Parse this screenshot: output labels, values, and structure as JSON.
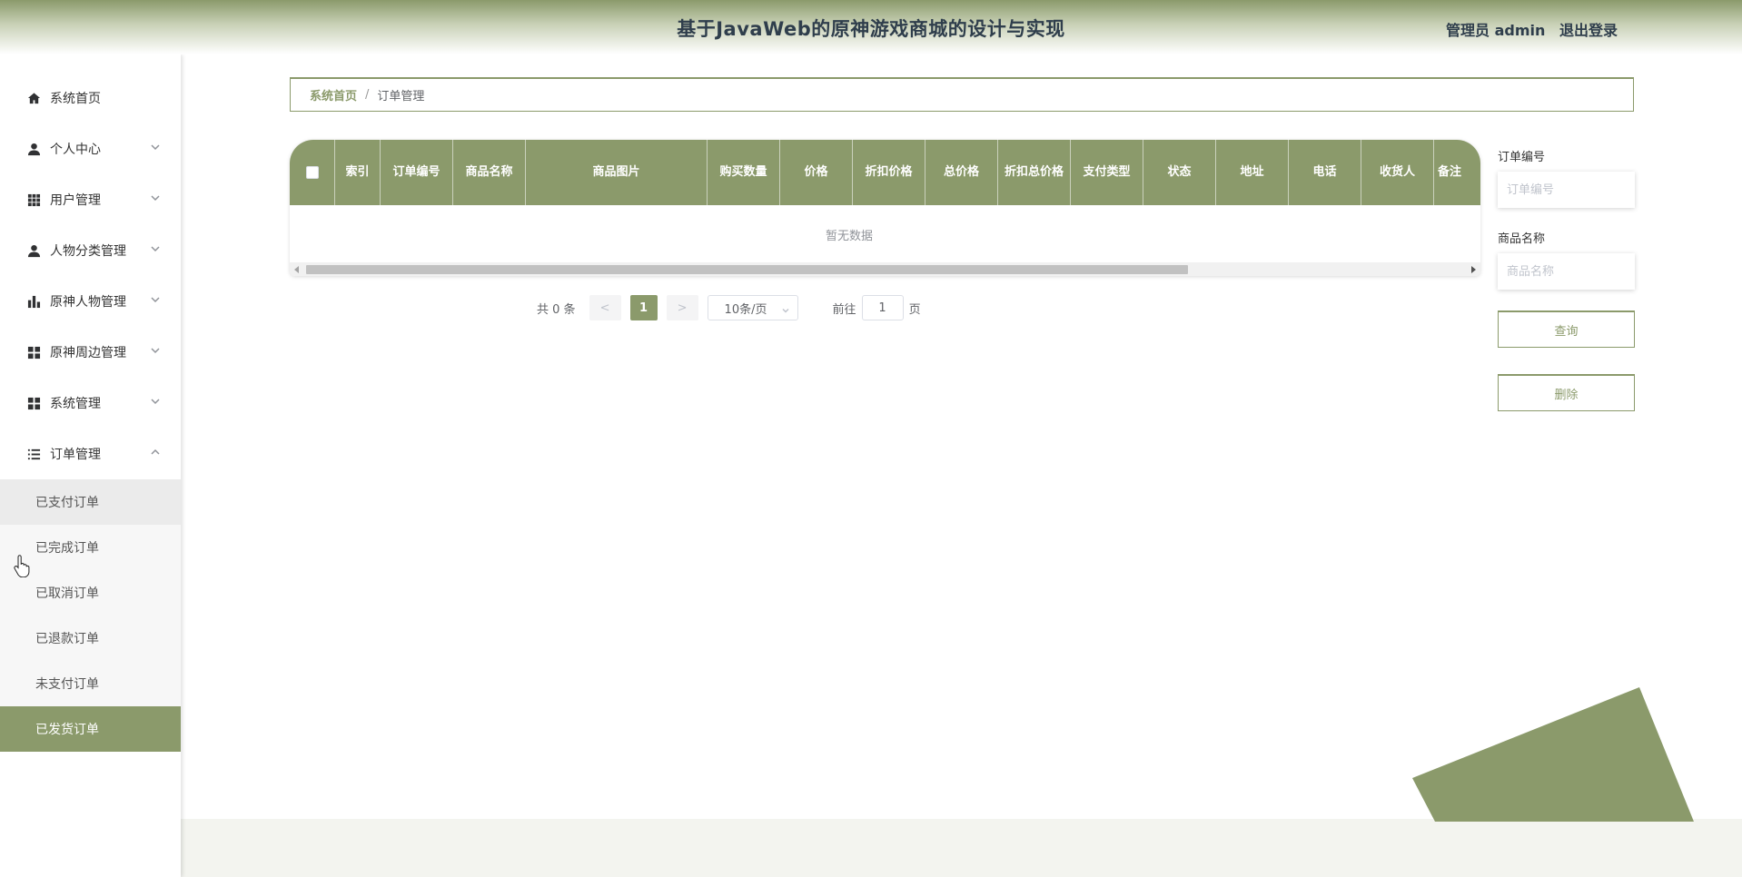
{
  "header": {
    "title": "基于JavaWeb的原神游戏商城的设计与实现",
    "user_label": "管理员 admin",
    "logout_label": "退出登录"
  },
  "sidebar": {
    "items": [
      {
        "label": "系统首页",
        "icon": "home-icon",
        "has_arrow": false
      },
      {
        "label": "个人中心",
        "icon": "user-icon",
        "has_arrow": true
      },
      {
        "label": "用户管理",
        "icon": "grid-icon",
        "has_arrow": true
      },
      {
        "label": "人物分类管理",
        "icon": "user-icon",
        "has_arrow": true
      },
      {
        "label": "原神人物管理",
        "icon": "bar-chart-icon",
        "has_arrow": true
      },
      {
        "label": "原神周边管理",
        "icon": "apps-icon",
        "has_arrow": true
      },
      {
        "label": "系统管理",
        "icon": "apps-icon",
        "has_arrow": true
      },
      {
        "label": "订单管理",
        "icon": "list-icon",
        "has_arrow": true,
        "expanded": true
      }
    ],
    "order_submenu": [
      {
        "label": "已支付订单",
        "state": "hover"
      },
      {
        "label": "已完成订单",
        "state": "normal"
      },
      {
        "label": "已取消订单",
        "state": "normal"
      },
      {
        "label": "已退款订单",
        "state": "normal"
      },
      {
        "label": "未支付订单",
        "state": "normal"
      },
      {
        "label": "已发货订单",
        "state": "active"
      }
    ]
  },
  "breadcrumb": {
    "home": "系统首页",
    "separator": "/",
    "current": "订单管理"
  },
  "table": {
    "columns": [
      "",
      "索引",
      "订单编号",
      "商品名称",
      "商品图片",
      "购买数量",
      "价格",
      "折扣价格",
      "总价格",
      "折扣总价格",
      "支付类型",
      "状态",
      "地址",
      "电话",
      "收货人",
      "备注"
    ],
    "rows": [],
    "empty_text": "暂无数据"
  },
  "pagination": {
    "total_text": "共 0 条",
    "prev": "<",
    "current_page": "1",
    "next": ">",
    "page_size": "10条/页",
    "goto_prefix": "前往",
    "goto_value": "1",
    "goto_suffix": "页"
  },
  "search": {
    "order_no_label": "订单编号",
    "order_no_placeholder": "订单编号",
    "goods_name_label": "商品名称",
    "goods_name_placeholder": "商品名称",
    "query_button": "查询",
    "delete_button": "删除"
  },
  "colors": {
    "accent": "#8b9a6b",
    "title_text": "#2f3e4c",
    "footer_band": "#f3f4ef"
  }
}
